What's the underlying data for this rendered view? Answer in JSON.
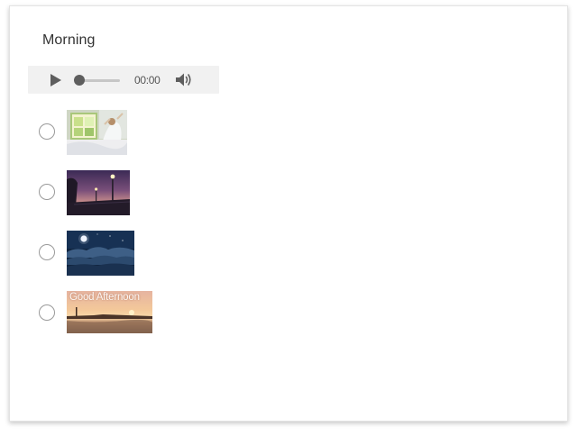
{
  "question": {
    "title": "Morning"
  },
  "audio_player": {
    "time": "00:00",
    "progress": 0,
    "play_icon": "play-icon",
    "volume_icon": "volume-icon"
  },
  "options": [
    {
      "id": "opt-1",
      "image": "woman-stretching-by-window-image",
      "selected": false
    },
    {
      "id": "opt-2",
      "image": "evening-waterfront-streetlights-image",
      "selected": false
    },
    {
      "id": "opt-3",
      "image": "night-moon-clouds-image",
      "selected": false
    },
    {
      "id": "opt-4",
      "image": "sunset-harbor-image",
      "caption": "Good Afternoon",
      "selected": false
    }
  ],
  "colors": {
    "player_bg": "#f1f1f1",
    "radio_border": "#9a9a9a",
    "title_text": "#333333"
  }
}
